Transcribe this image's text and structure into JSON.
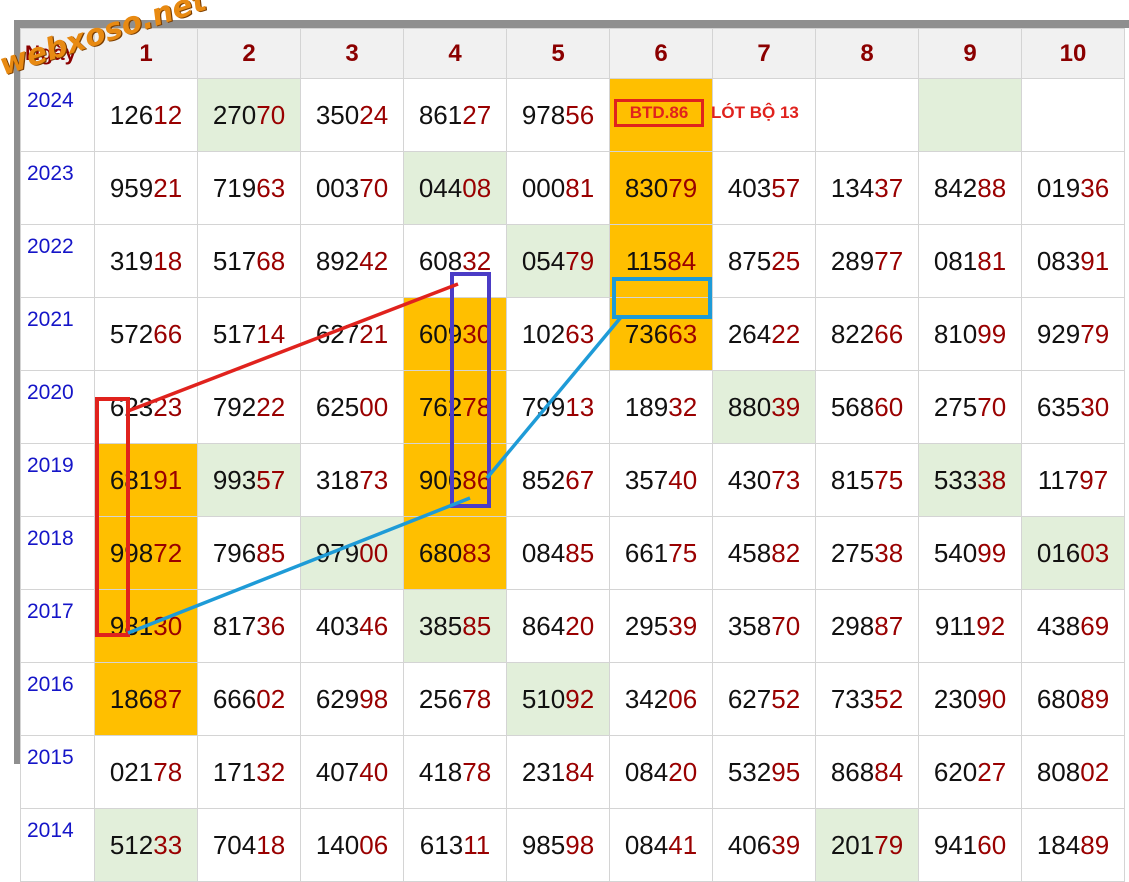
{
  "watermark": "webxoso.net",
  "header": {
    "first": "Ngày",
    "cols": [
      "1",
      "2",
      "3",
      "4",
      "5",
      "6",
      "7",
      "8",
      "9",
      "10"
    ]
  },
  "rows": [
    {
      "year": "2024",
      "cells": [
        "12612",
        "27070",
        "35024",
        "86127",
        "97856",
        "",
        "",
        "",
        "",
        ""
      ]
    },
    {
      "year": "2023",
      "cells": [
        "95921",
        "71963",
        "00370",
        "04408",
        "00081",
        "83079",
        "40357",
        "13437",
        "84288",
        "01936"
      ]
    },
    {
      "year": "2022",
      "cells": [
        "31918",
        "51768",
        "89242",
        "60832",
        "05479",
        "11584",
        "87525",
        "28977",
        "08181",
        "08391"
      ]
    },
    {
      "year": "2021",
      "cells": [
        "57266",
        "51714",
        "62721",
        "60930",
        "10263",
        "73663",
        "26422",
        "82266",
        "81099",
        "92979"
      ]
    },
    {
      "year": "2020",
      "cells": [
        "62323",
        "79222",
        "62500",
        "76278",
        "79913",
        "18932",
        "88039",
        "56860",
        "27570",
        "63530"
      ]
    },
    {
      "year": "2019",
      "cells": [
        "68191",
        "99357",
        "31873",
        "90686",
        "85267",
        "35740",
        "43073",
        "81575",
        "53338",
        "11797"
      ]
    },
    {
      "year": "2018",
      "cells": [
        "99872",
        "79685",
        "97900",
        "68083",
        "08485",
        "66175",
        "45882",
        "27538",
        "54099",
        "01603"
      ]
    },
    {
      "year": "2017",
      "cells": [
        "98130",
        "81736",
        "40346",
        "38585",
        "86420",
        "29539",
        "35870",
        "29887",
        "91192",
        "43869"
      ]
    },
    {
      "year": "2016",
      "cells": [
        "18687",
        "66602",
        "62998",
        "25678",
        "51092",
        "34206",
        "62752",
        "73352",
        "23090",
        "68089"
      ]
    },
    {
      "year": "2015",
      "cells": [
        "02178",
        "17132",
        "40740",
        "41878",
        "23184",
        "08420",
        "53295",
        "86884",
        "62027",
        "80802"
      ]
    },
    {
      "year": "2014",
      "cells": [
        "51233",
        "70418",
        "14006",
        "61311",
        "98598",
        "08441",
        "40639",
        "20179",
        "94160",
        "18489"
      ]
    }
  ],
  "highlights": {
    "orange": [
      [
        0,
        5
      ],
      [
        1,
        5
      ],
      [
        2,
        5
      ],
      [
        3,
        3
      ],
      [
        3,
        5
      ],
      [
        4,
        3
      ],
      [
        5,
        0
      ],
      [
        5,
        3
      ],
      [
        6,
        0
      ],
      [
        6,
        3
      ],
      [
        7,
        0
      ],
      [
        8,
        0
      ]
    ],
    "green": [
      [
        0,
        1
      ],
      [
        0,
        8
      ],
      [
        1,
        3
      ],
      [
        2,
        4
      ],
      [
        4,
        6
      ],
      [
        5,
        1
      ],
      [
        5,
        8
      ],
      [
        6,
        2
      ],
      [
        6,
        9
      ],
      [
        7,
        3
      ],
      [
        8,
        4
      ],
      [
        10,
        0
      ],
      [
        10,
        7
      ]
    ]
  },
  "annotations": {
    "box_label": "BTD.86",
    "side_label": "LÓT BỘ 13"
  },
  "colors": {
    "orange": "#ffbf00",
    "green": "#e2efda",
    "header_text": "#8b0000",
    "year_text": "#1515c8",
    "red_mark": "#e0221d",
    "blue_mark": "#1e9bd7",
    "purple_mark": "#4b3cc6"
  }
}
